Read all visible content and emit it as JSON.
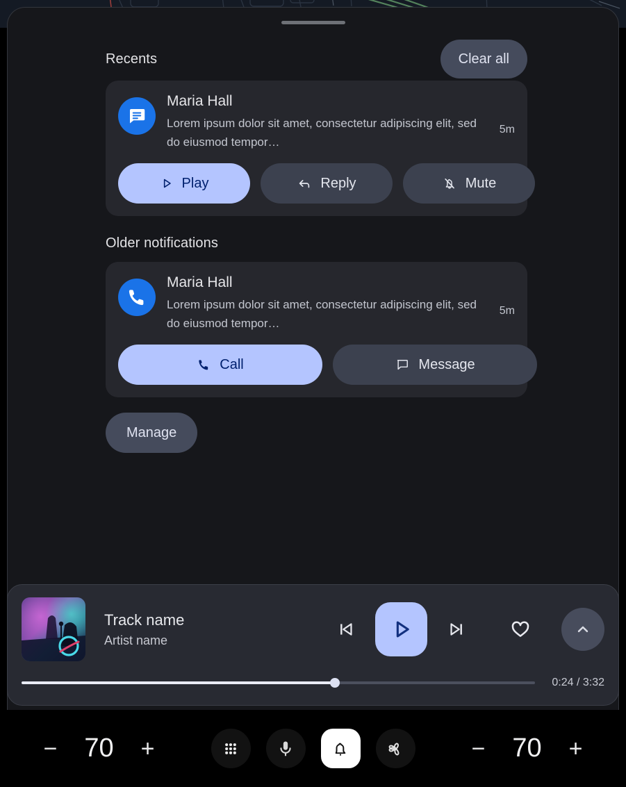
{
  "background": {
    "name": "navigation-map-strip",
    "base_color": "#141a24",
    "route_color": "#5c8f63"
  },
  "panel": {
    "drag_handle": "drag-handle",
    "recents": {
      "title": "Recents",
      "clear_all_label": "Clear all"
    },
    "older": {
      "title": "Older notifications"
    },
    "manage_label": "Manage",
    "notifications": [
      {
        "icon": "message-icon",
        "icon_bg": "#1a73e8",
        "title": "Maria Hall",
        "body": "Lorem ipsum dolor sit amet, consectetur adipiscing elit, sed do eiusmod tempor…",
        "time": "5m",
        "actions": [
          {
            "label": "Play",
            "icon": "play-icon",
            "style": "primary"
          },
          {
            "label": "Reply",
            "icon": "reply-icon",
            "style": "secondary"
          },
          {
            "label": "Mute",
            "icon": "bell-off-icon",
            "style": "secondary"
          }
        ]
      },
      {
        "icon": "phone-icon",
        "icon_bg": "#1a73e8",
        "title": "Maria Hall",
        "body": "Lorem ipsum dolor sit amet, consectetur adipiscing elit, sed do eiusmod tempor…",
        "time": "5m",
        "actions": [
          {
            "label": "Call",
            "icon": "phone-icon",
            "style": "primary"
          },
          {
            "label": "Message",
            "icon": "chat-bubble-icon",
            "style": "secondary"
          }
        ]
      }
    ]
  },
  "media": {
    "album_art": "concert-stage-photo",
    "track_name": "Track name",
    "artist_name": "Artist name",
    "controls": {
      "previous": "skip-previous-icon",
      "play": "play-icon",
      "next": "skip-next-icon",
      "favorite": "heart-outline-icon",
      "expand": "chevron-up-icon"
    },
    "progress": {
      "elapsed": "0:24",
      "duration": "3:32",
      "time_label": "0:24 / 3:32",
      "percent": 61
    },
    "accent_color": "#b4c5ff"
  },
  "bottom_bar": {
    "left_volume": {
      "minus": "−",
      "value": "70",
      "plus": "+"
    },
    "right_volume": {
      "minus": "−",
      "value": "70",
      "plus": "+"
    },
    "quick_icons": [
      {
        "name": "apps-grid-icon",
        "active": false
      },
      {
        "name": "microphone-icon",
        "active": false
      },
      {
        "name": "bell-icon",
        "active": true
      },
      {
        "name": "fan-climate-icon",
        "active": false
      }
    ]
  }
}
